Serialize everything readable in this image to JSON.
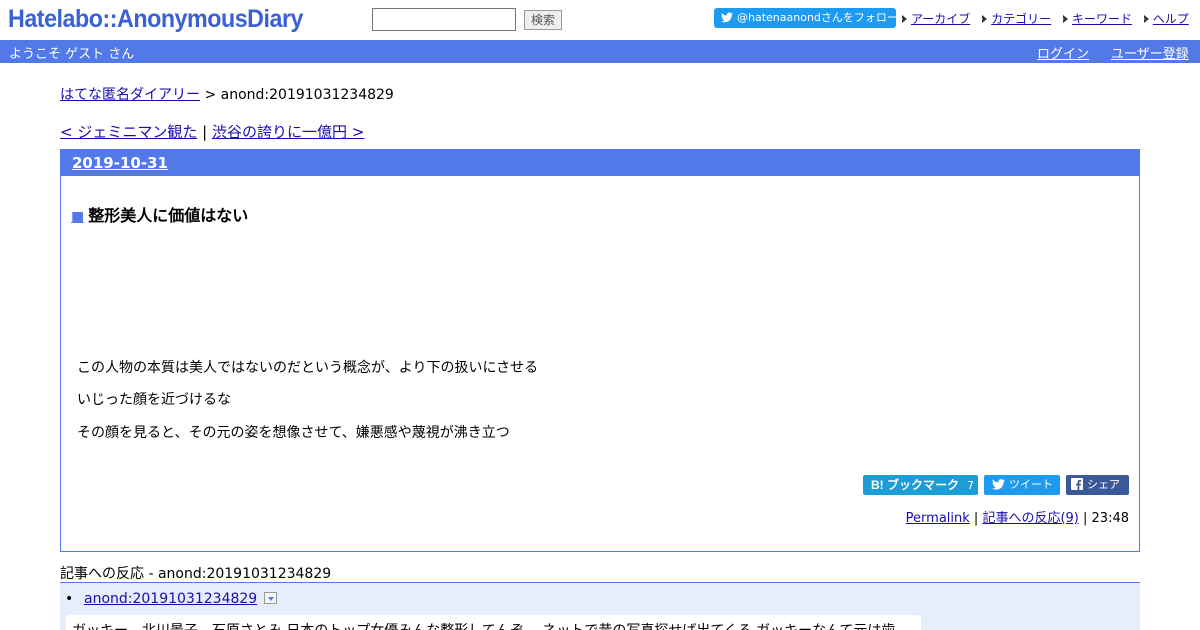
{
  "header": {
    "logo": "Hatelabo::AnonymousDiary",
    "search_value": "",
    "search_button": "検索",
    "follow_label": "@hatenaanondさんをフォロー",
    "links": [
      "アーカイブ",
      "カテゴリー",
      "キーワード",
      "ヘルプ"
    ]
  },
  "userbar": {
    "welcome": "ようこそ ゲスト さん",
    "login": "ログイン",
    "register": "ユーザー登録"
  },
  "breadcrumb": {
    "home": "はてな匿名ダイアリー",
    "separator": " > ",
    "current": "anond:20191031234829"
  },
  "navigation": {
    "prev": "< ジェミニマン観た",
    "divider": " | ",
    "next": "渋谷の誇りに一億円 >"
  },
  "entry": {
    "date": "2019-10-31",
    "title_marker": "■",
    "title": "整形美人に価値はない",
    "body": [
      "この人物の本質は美人ではないのだという概念が、より下の扱いにさせる",
      "いじった顔を近づけるな",
      "その顔を見ると、その元の姿を想像させて、嫌悪感や蔑視が沸き立つ"
    ],
    "share": {
      "bookmark_label": "B! ブックマーク",
      "bookmark_count": "7",
      "tweet_label": "ツイート",
      "share_label": "シェア"
    },
    "footer": {
      "permalink": "Permalink",
      "sep1": " | ",
      "reactions": "記事への反応(9)",
      "sep2": " | ",
      "time": "23:48"
    }
  },
  "reactions": {
    "heading": "記事への反応 - anond:20191031234829",
    "items": [
      {
        "link": "anond:20191031234829",
        "text": "ガッキー、北川景子、石原さとみ 日本のトップ女優みんな整形してんぞ。 ネットで昔の写真探せば出てくる ガッキーなんて元は歯"
      }
    ]
  },
  "colors": {
    "accent": "#5279e7",
    "logo": "#3a60d6",
    "twitter": "#1d9bf0",
    "hatena": "#1a9ed8",
    "facebook": "#3b5998",
    "reaction_bg": "#e6edfb"
  }
}
